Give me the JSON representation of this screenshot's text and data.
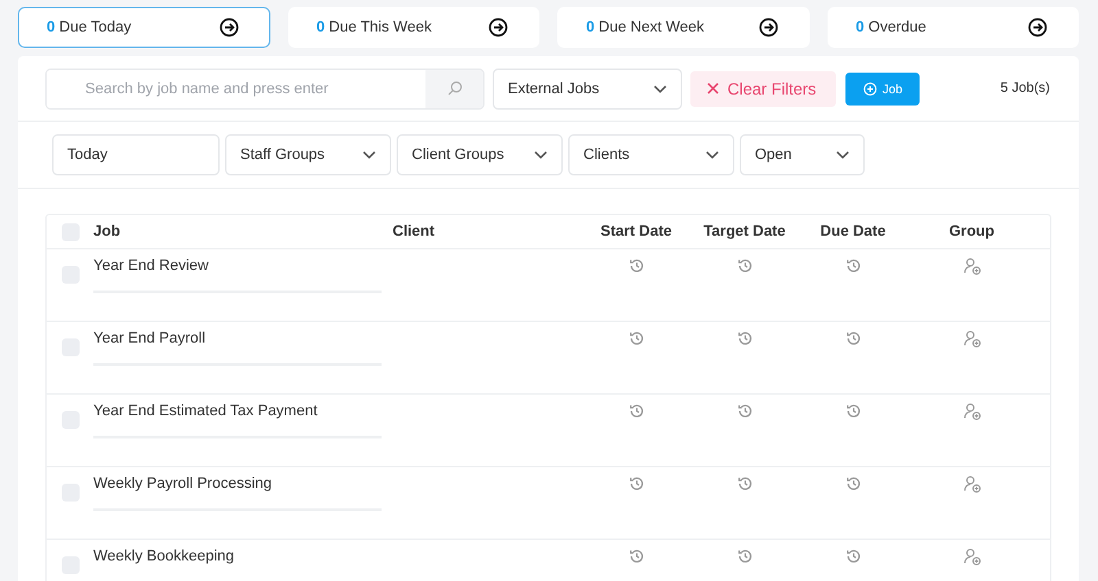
{
  "summary_cards": [
    {
      "count": "0",
      "label": "Due Today",
      "selected": true
    },
    {
      "count": "0",
      "label": "Due This Week",
      "selected": false
    },
    {
      "count": "0",
      "label": "Due Next Week",
      "selected": false
    },
    {
      "count": "0",
      "label": "Overdue",
      "selected": false
    }
  ],
  "search": {
    "placeholder": "Search by job name and press enter"
  },
  "job_type": {
    "value": "External Jobs"
  },
  "clear_filters": "Clear Filters",
  "add_job": "Job",
  "job_count": "5 Job(s)",
  "filters": [
    {
      "kind": "text",
      "value": "Today"
    },
    {
      "kind": "dropdown",
      "value": "Staff Groups"
    },
    {
      "kind": "dropdown",
      "value": "Client Groups"
    },
    {
      "kind": "dropdown",
      "value": "Clients"
    },
    {
      "kind": "dropdown",
      "value": "Open"
    }
  ],
  "table": {
    "all_checked": false,
    "columns": [
      "Job",
      "Client",
      "Start Date",
      "Target Date",
      "Due Date",
      "Group"
    ],
    "rows": [
      {
        "job": "Year End Review",
        "checked": false
      },
      {
        "job": "Year End Payroll",
        "checked": false
      },
      {
        "job": "Year End Estimated Tax Payment",
        "checked": false
      },
      {
        "job": "Weekly Payroll Processing",
        "checked": false
      },
      {
        "job": "Weekly Bookkeeping",
        "checked": false
      }
    ]
  }
}
